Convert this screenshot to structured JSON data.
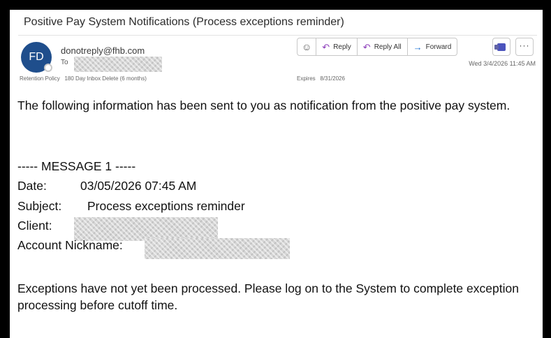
{
  "email": {
    "subject": "Positive Pay System Notifications (Process exceptions reminder)",
    "avatar_initials": "FD",
    "sender": "donotreply@fhb.com",
    "to_label": "To",
    "retention_label": "Retention Policy",
    "retention_value": "180 Day Inbox Delete (6 months)",
    "expires_label": "Expires",
    "expires_value": "8/31/2026",
    "date": "Wed 3/4/2026 11:45 AM",
    "avatar_color": "#1f4e8c"
  },
  "toolbar": {
    "emoji_icon": "smiley-icon",
    "reply_label": "Reply",
    "reply_all_label": "Reply All",
    "forward_label": "Forward",
    "teams_icon": "teams-icon",
    "more_icon": "more-dots-icon"
  },
  "body": {
    "intro": "The following information has been sent to you as notification from the positive pay system.",
    "message_header": "----- MESSAGE 1 -----",
    "date_label": "Date:",
    "date_value": "03/05/2026 07:45 AM",
    "subject_label": "Subject:",
    "subject_value": "Process exceptions reminder",
    "client_label": "Client:",
    "nickname_label": "Account Nickname:",
    "closing": "Exceptions have not yet been processed. Please log on to the System to complete exception processing before cutoff time."
  }
}
